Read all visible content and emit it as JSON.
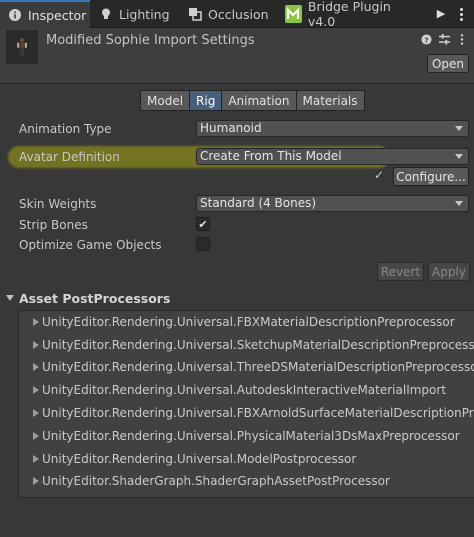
{
  "tabs": [
    {
      "label": "Inspector",
      "icon": "info-icon"
    },
    {
      "label": "Lighting",
      "icon": "lightbulb-icon"
    },
    {
      "label": "Occlusion",
      "icon": "occlusion-icon"
    },
    {
      "label": "Bridge Plugin v4.0",
      "icon": "bridge-m-icon"
    }
  ],
  "header": {
    "title": "Modified Sophie Import Settings",
    "open_label": "Open"
  },
  "sections": [
    "Model",
    "Rig",
    "Animation",
    "Materials"
  ],
  "active_section": "Rig",
  "rig": {
    "animation_type_label": "Animation Type",
    "animation_type_value": "Humanoid",
    "avatar_definition_label": "Avatar Definition",
    "avatar_definition_value": "Create From This Model",
    "configure_label": "Configure...",
    "skin_weights_label": "Skin Weights",
    "skin_weights_value": "Standard (4 Bones)",
    "strip_bones_label": "Strip Bones",
    "strip_bones_checked": true,
    "optimize_label": "Optimize Game Objects",
    "optimize_checked": false
  },
  "actions": {
    "revert": "Revert",
    "apply": "Apply"
  },
  "postprocessors": {
    "title": "Asset PostProcessors",
    "items": [
      "UnityEditor.Rendering.Universal.FBXMaterialDescriptionPreprocessor",
      "UnityEditor.Rendering.Universal.SketchupMaterialDescriptionPreprocessor",
      "UnityEditor.Rendering.Universal.ThreeDSMaterialDescriptionPreprocessor",
      "UnityEditor.Rendering.Universal.AutodeskInteractiveMaterialImport",
      "UnityEditor.Rendering.Universal.FBXArnoldSurfaceMaterialDescriptionPreprocessor",
      "UnityEditor.Rendering.Universal.PhysicalMaterial3DsMaxPreprocessor",
      "UnityEditor.Rendering.Universal.ModelPostprocessor",
      "UnityEditor.ShaderGraph.ShaderGraphAssetPostProcessor"
    ]
  },
  "colors": {
    "background": "#383838",
    "active_tab_accent": "#3a79bb",
    "selected_segment": "#46607c",
    "highlight": "#d6d600"
  }
}
